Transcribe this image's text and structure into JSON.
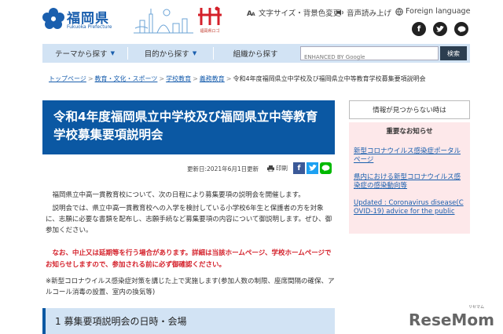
{
  "header": {
    "logo_title": "福岡県",
    "logo_sub": "Fukuoka Prefecture",
    "city_logo_text": "福岡県ロゴ",
    "util": {
      "text_size": "文字サイズ・背景色変更",
      "read_aloud": "音声読み上げ",
      "foreign": "Foreign language"
    },
    "social": [
      "facebook",
      "twitter",
      "line"
    ]
  },
  "nav": {
    "items": [
      "テーマから探す",
      "目的から探す",
      "組織から探す"
    ],
    "search_placeholder": "ENHANCED BY Google",
    "search_button": "検索"
  },
  "breadcrumb": {
    "items": [
      "トップページ",
      "教育・文化・スポーツ",
      "学校教育",
      "義務教育"
    ],
    "current": "令和4年度福岡県立中学校及び福岡県立中等教育学校募集要項説明会"
  },
  "article": {
    "title": "令和4年度福岡県立中学校及び福岡県立中等教育学校募集要項説明会",
    "updated": "更新日:2021年6月1日更新",
    "print": "印刷",
    "para1": "福岡県立中高一貫教育校について、次の日程により募集要項の説明会を開催します。",
    "para2": "説明会では、県立中高一貫教育校への入学を検討している小学校6年生と保護者の方を対象に、志願に必要な書類を配布し、志願手続など募集要項の内容について御説明します。ぜひ、御参加ください。",
    "notice": "なお、中止又は延期等を行う場合があります。詳細は当該ホームページ、学校ホームページでお知らせしますので、参加される前に必ず御確認ください。",
    "para3": "※新型コロナウイルス感染症対策を講じた上で実施します(参加人数の制限、座席間隔の確保、アルコール消毒の設置、室内の換気等)",
    "section1": "1 募集要項説明会の日時・会場"
  },
  "sidebar": {
    "not_found": "情報が見つからない時は",
    "important_head": "重要なお知らせ",
    "links": [
      "新型コロナウイルス感染症ポータルページ",
      "県内における新型コロナウイルス感染症の感染動向等",
      "Updated : Coronavirus disease(COVID-19) advice for the public"
    ]
  },
  "watermark": {
    "text": "ReseMom",
    "ruby": "リセマム"
  },
  "colors": {
    "brand_blue": "#0b58a3",
    "nav_bg": "#d2e3f4",
    "notice_red": "#d4202a",
    "important_bg": "#fde8ea"
  }
}
